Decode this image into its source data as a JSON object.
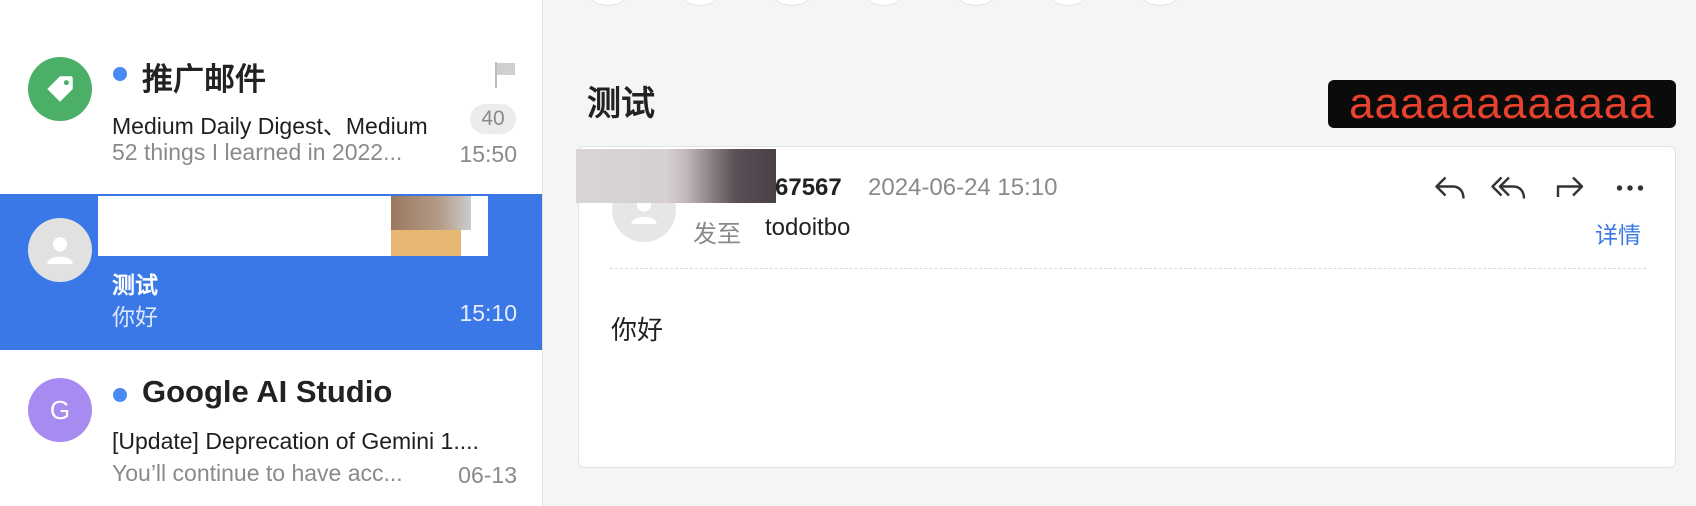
{
  "mail_list": [
    {
      "sender": "推广邮件",
      "subject": "Medium Daily Digest、Medium",
      "preview": "52 things I learned in 2022...",
      "time": "15:50",
      "count": "40",
      "unread": true,
      "avatar_color": "#4caf67"
    },
    {
      "sender": "",
      "subject": "测试",
      "preview": "你好",
      "time": "15:10",
      "selected": true,
      "avatar_color": "#e1e1e1"
    },
    {
      "sender": "Google AI Studio",
      "avatar_letter": "G",
      "subject": "[Update] Deprecation of Gemini 1....",
      "preview": "You’ll continue to have acc...",
      "time": "06-13",
      "unread": true,
      "avatar_color": "#a78bf0"
    }
  ],
  "reading": {
    "title": "测试",
    "overlay_text": "aaaaaaaaaaaa",
    "from_suffix": "67567",
    "date": "2024-06-24 15:10",
    "to_label": "发至",
    "to_value": "todoitbo",
    "details_link": "详情",
    "body": "你好"
  },
  "colors": {
    "accent": "#3b78e7",
    "unread_dot": "#4a8af4",
    "overlay_text": "#e8412e"
  },
  "icons": [
    "tag-icon",
    "flag-icon",
    "user-icon",
    "reply-icon",
    "reply-all-icon",
    "forward-icon",
    "more-icon"
  ]
}
